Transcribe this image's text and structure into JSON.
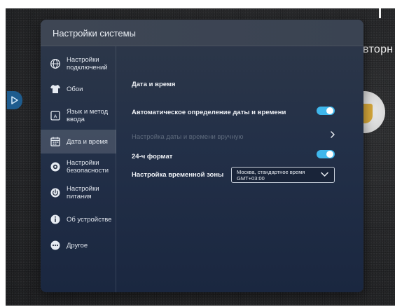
{
  "background": {
    "partial_text": "вторн"
  },
  "panel": {
    "title": "Настройки системы"
  },
  "sidebar": {
    "items": [
      {
        "label": "Настройки\nподключений",
        "icon": "globe-icon",
        "active": false
      },
      {
        "label": "Обои",
        "icon": "shirt-icon",
        "active": false
      },
      {
        "label": "Язык и метод\nввода",
        "icon": "keyboard-a-icon",
        "active": false
      },
      {
        "label": "Дата и время",
        "icon": "calendar-icon",
        "active": true
      },
      {
        "label": "Настройки\nбезопасности",
        "icon": "security-icon",
        "active": false
      },
      {
        "label": "Настройки\nпитания",
        "icon": "power-icon",
        "active": false
      },
      {
        "label": "Об устройстве",
        "icon": "info-icon",
        "active": false
      },
      {
        "label": "Другое",
        "icon": "more-icon",
        "active": false
      }
    ]
  },
  "content": {
    "section_title": "Дата и время",
    "auto_datetime_label": "Автоматическое определение даты и времени",
    "auto_datetime_on": true,
    "manual_datetime_label": "Настройка даты и времени вручную",
    "format24_label": "24-ч формат",
    "format24_on": true,
    "timezone_label": "Настройка временной зоны",
    "timezone_value": "Москва, стандартное время\nGMT+03:00"
  },
  "colors": {
    "accent": "#3fb7ec",
    "side_button": "#1e5c8e"
  }
}
